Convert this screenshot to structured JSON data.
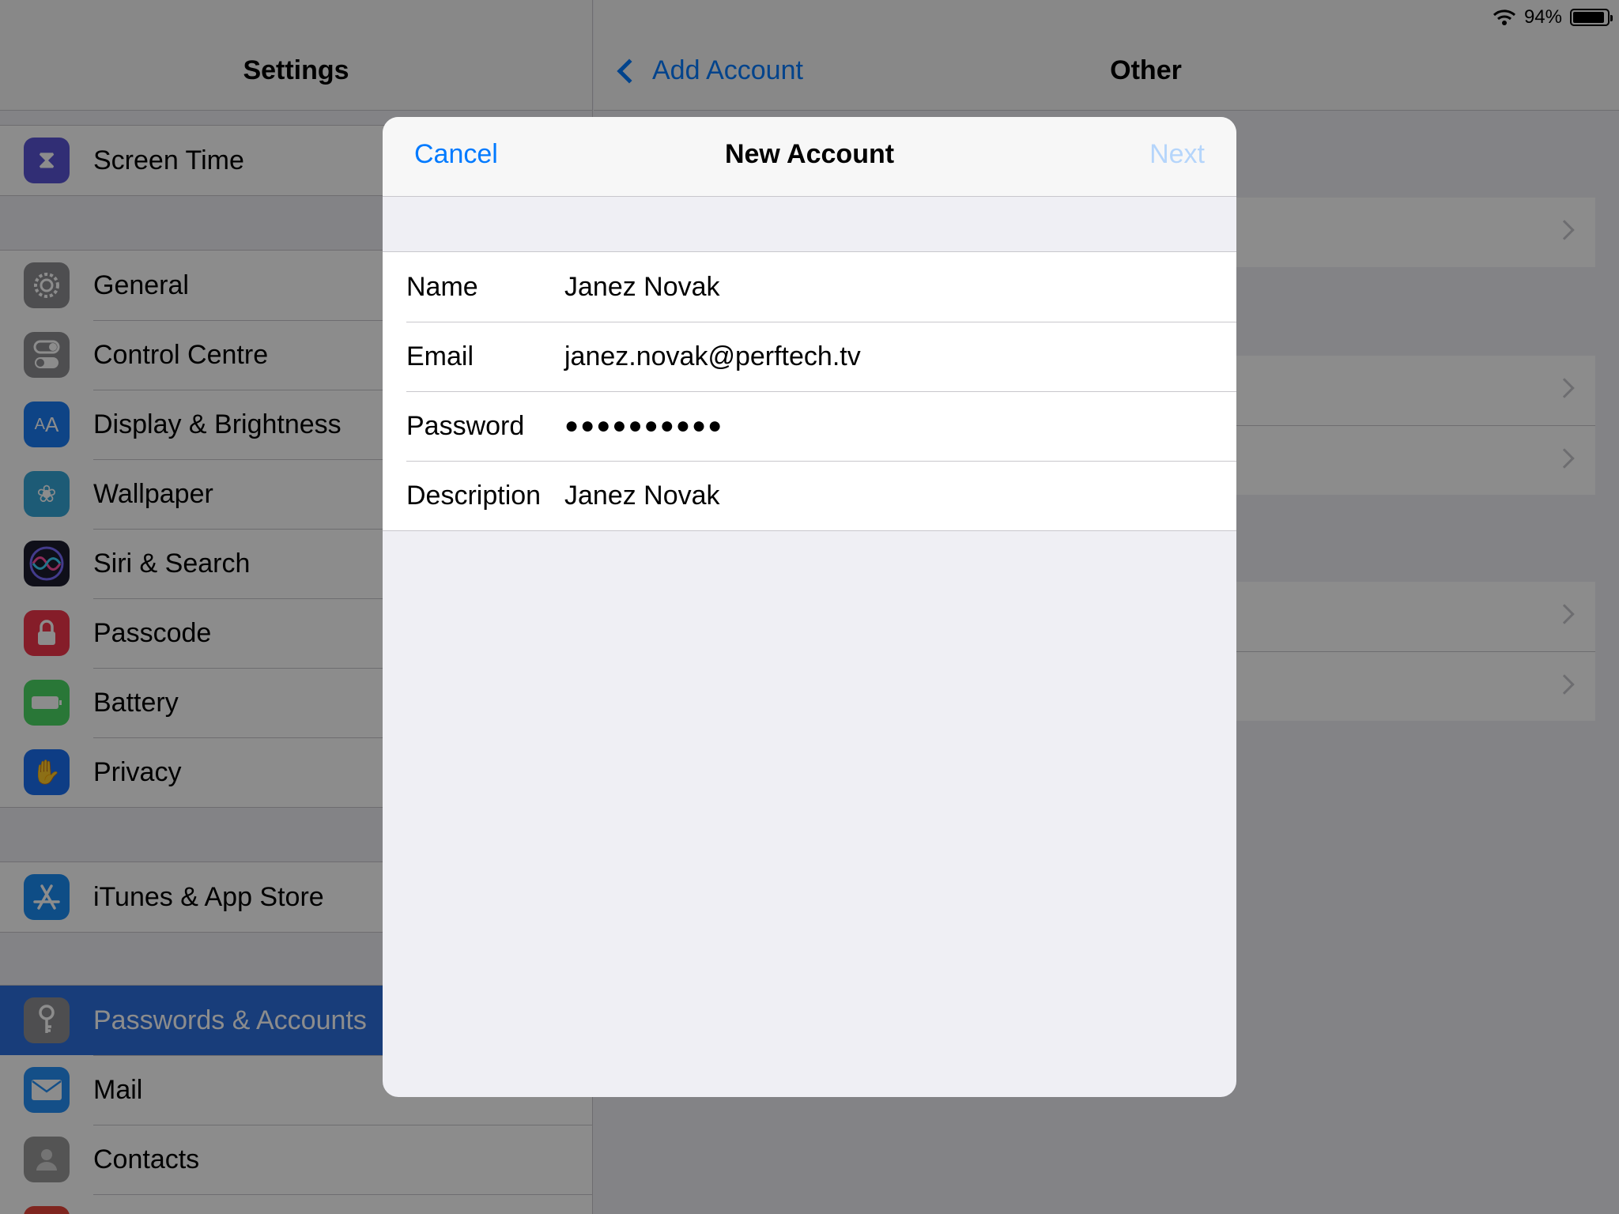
{
  "status": {
    "battery_pct": "94%",
    "battery_level": 0.94,
    "wifi_icon": "wifi-icon"
  },
  "sidebar": {
    "title": "Settings",
    "groups": [
      {
        "items": [
          {
            "label": "Screen Time",
            "icon": "hourglass-icon",
            "color": "#5a55d6"
          }
        ]
      },
      {
        "items": [
          {
            "label": "General",
            "icon": "gear-icon",
            "color": "#8e8e93"
          },
          {
            "label": "Control Centre",
            "icon": "switches-icon",
            "color": "#8e8e93"
          },
          {
            "label": "Display & Brightness",
            "icon": "text-size-icon",
            "color": "#1a7cf5"
          },
          {
            "label": "Wallpaper",
            "icon": "flower-icon",
            "color": "#36a6d8"
          },
          {
            "label": "Siri & Search",
            "icon": "siri-icon",
            "color": "#222222"
          },
          {
            "label": "Passcode",
            "icon": "lock-icon",
            "color": "#f2364b"
          },
          {
            "label": "Battery",
            "icon": "battery-icon",
            "color": "#4cd964"
          },
          {
            "label": "Privacy",
            "icon": "hand-icon",
            "color": "#1a6ff2"
          }
        ]
      },
      {
        "items": [
          {
            "label": "iTunes & App Store",
            "icon": "app-store-icon",
            "color": "#1a8cf5"
          }
        ]
      },
      {
        "items": [
          {
            "label": "Passwords & Accounts",
            "icon": "key-icon",
            "color": "#8e8e93",
            "selected": true
          },
          {
            "label": "Mail",
            "icon": "envelope-icon",
            "color": "#2591f7"
          },
          {
            "label": "Contacts",
            "icon": "contacts-icon",
            "color": "#9a9a9a"
          }
        ]
      }
    ]
  },
  "detail": {
    "back_label": "Add Account",
    "title": "Other"
  },
  "modal": {
    "cancel_label": "Cancel",
    "title": "New Account",
    "next_label": "Next",
    "fields": [
      {
        "label": "Name",
        "value": "Janez Novak"
      },
      {
        "label": "Email",
        "value": "janez.novak@perftech.tv"
      },
      {
        "label": "Password",
        "value": "●●●●●●●●●●"
      },
      {
        "label": "Description",
        "value": "Janez Novak"
      }
    ]
  }
}
